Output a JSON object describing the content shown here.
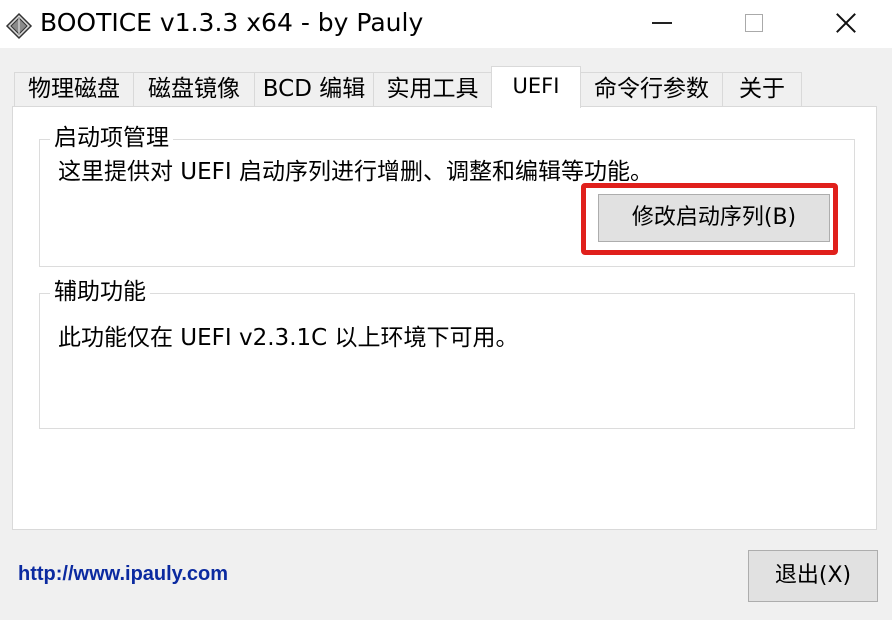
{
  "window": {
    "title": "BOOTICE v1.3.3 x64 - by Pauly",
    "icon": "disk-app-icon"
  },
  "tabs": [
    {
      "label": "物理磁盘",
      "active": false
    },
    {
      "label": "磁盘镜像",
      "active": false
    },
    {
      "label": "BCD 编辑",
      "active": false
    },
    {
      "label": "实用工具",
      "active": false
    },
    {
      "label": "UEFI",
      "active": true
    },
    {
      "label": "命令行参数",
      "active": false
    },
    {
      "label": "关于",
      "active": false
    }
  ],
  "boot_manager": {
    "title": "启动项管理",
    "description": "这里提供对 UEFI 启动序列进行增删、调整和编辑等功能。",
    "button_label": "修改启动序列(B)"
  },
  "auxiliary": {
    "title": "辅助功能",
    "description": "此功能仅在 UEFI v2.3.1C 以上环境下可用。"
  },
  "footer": {
    "link_text": "http://www.ipauly.com",
    "exit_label": "退出(X)"
  },
  "colors": {
    "highlight": "#e0201c",
    "link": "#0b2aa0"
  }
}
